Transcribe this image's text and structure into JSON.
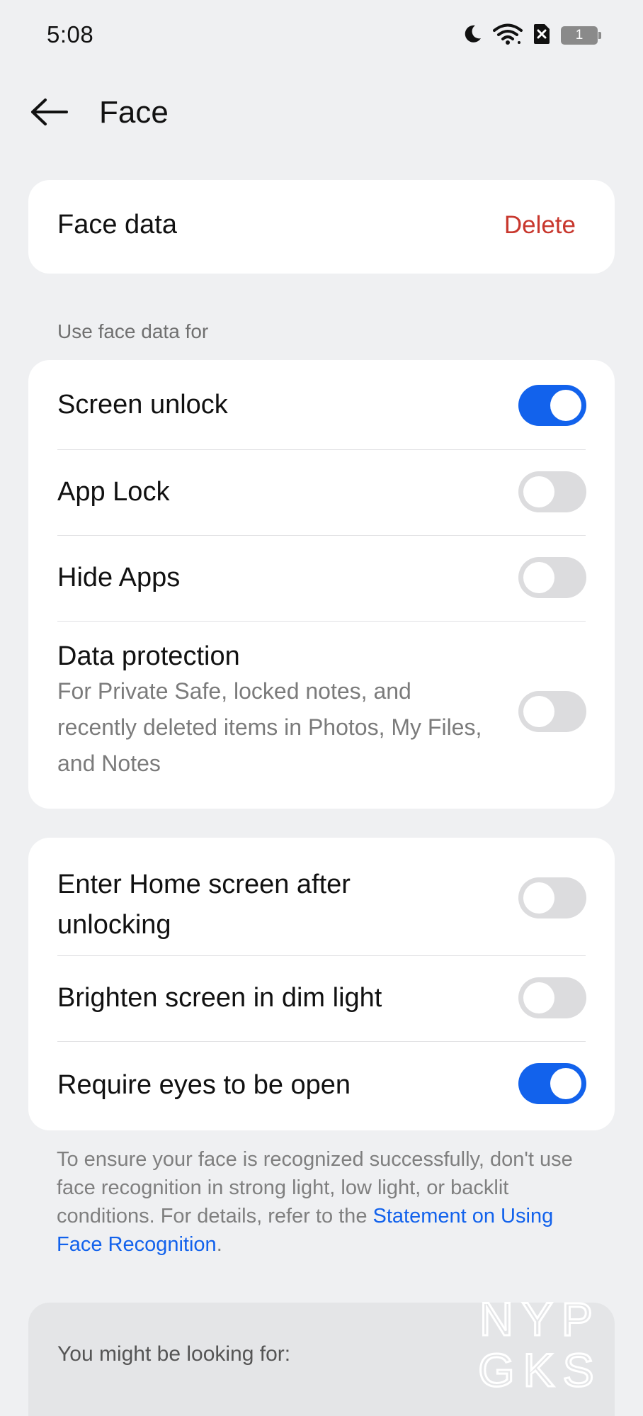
{
  "status_bar": {
    "time": "5:08",
    "icons": [
      "moon-icon",
      "wifi-icon",
      "no-sim-icon",
      "battery-icon"
    ],
    "battery_level": "1"
  },
  "header": {
    "title": "Face",
    "back_icon": "arrow-left-icon"
  },
  "face_data": {
    "label": "Face data",
    "delete_label": "Delete"
  },
  "use_section": {
    "header": "Use face data for",
    "items": [
      {
        "label": "Screen unlock",
        "enabled": true
      },
      {
        "label": "App Lock",
        "enabled": false
      },
      {
        "label": "Hide Apps",
        "enabled": false
      },
      {
        "label": "Data protection",
        "subtitle": "For Private Safe, locked notes, and recently deleted items in Photos, My Files, and Notes",
        "enabled": false
      }
    ]
  },
  "options_section": {
    "items": [
      {
        "label": "Enter Home screen after unlocking",
        "enabled": false
      },
      {
        "label": "Brighten screen in dim light",
        "enabled": false
      },
      {
        "label": "Require eyes to be open",
        "enabled": true
      }
    ]
  },
  "footnote": {
    "text": "To ensure your face is recognized successfully, don't use face recognition in strong light, low light, or backlit conditions. For details, refer to the ",
    "link": "Statement on Using Face Recognition",
    "end": "."
  },
  "suggestions": {
    "title": "You might be looking for:"
  },
  "watermark": {
    "line1": "NYP",
    "line2": "GKS"
  },
  "colors": {
    "background": "#eff0f2",
    "card": "#ffffff",
    "accent": "#1262ec",
    "delete": "#c8372d",
    "toggle_off": "#dcdcde"
  }
}
